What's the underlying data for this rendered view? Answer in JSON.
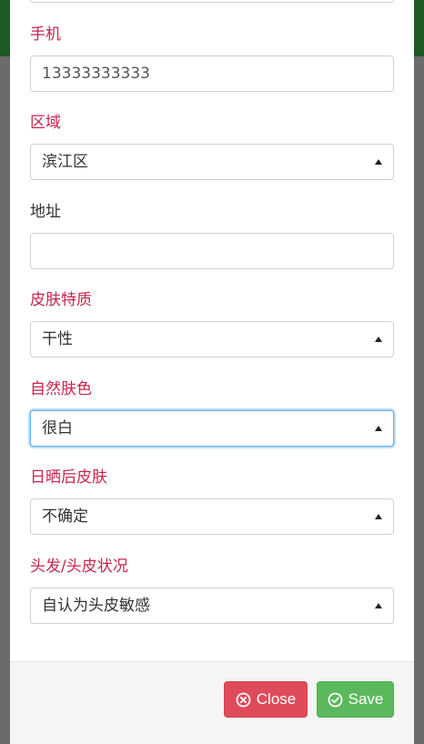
{
  "form": {
    "fields": [
      {
        "label": "手机",
        "required": true,
        "type": "text",
        "value": "13333333333"
      },
      {
        "label": "区域",
        "required": true,
        "type": "select",
        "value": "滨江区"
      },
      {
        "label": "地址",
        "required": false,
        "type": "text",
        "value": ""
      },
      {
        "label": "皮肤特质",
        "required": true,
        "type": "select",
        "value": "干性"
      },
      {
        "label": "自然肤色",
        "required": true,
        "type": "select",
        "value": "很白",
        "focused": true
      },
      {
        "label": "日晒后皮肤",
        "required": true,
        "type": "select",
        "value": "不确定"
      },
      {
        "label": "头发/头皮状况",
        "required": true,
        "type": "select",
        "value": "自认为头皮敏感"
      }
    ]
  },
  "footer": {
    "close_label": "Close",
    "save_label": "Save",
    "close_color": "#e04b59",
    "save_color": "#5cb85c",
    "close_icon": "circle-x-icon",
    "save_icon": "circle-check-icon"
  },
  "colors": {
    "required_label": "#c7254e",
    "normal_label": "#333333",
    "backdrop": "#6b6b6b",
    "header": "#1d5a24",
    "focus_border": "#66afe9"
  }
}
